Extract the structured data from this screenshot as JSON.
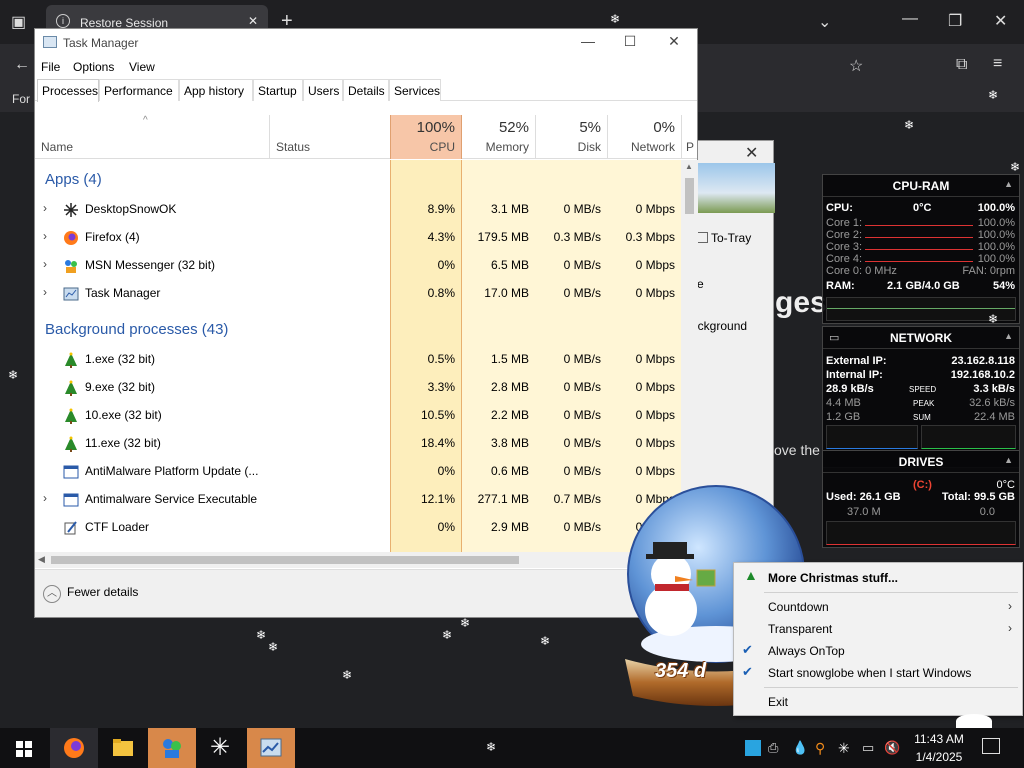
{
  "browser": {
    "tab_title": "Restore Session",
    "bookmarks_text": "For",
    "page_heading": "ges",
    "page_body_text": "ove the"
  },
  "restore_dialog": {
    "to_tray": "To-Tray",
    "option_e": "e",
    "background_label": "ackground"
  },
  "taskmanager": {
    "title": "Task Manager",
    "menu": [
      "File",
      "Options",
      "View"
    ],
    "tabs": [
      "Processes",
      "Performance",
      "App history",
      "Startup",
      "Users",
      "Details",
      "Services"
    ],
    "active_tab": "Processes",
    "columns": {
      "name": "Name",
      "status": "Status",
      "cpu_pct": "100%",
      "cpu": "CPU",
      "mem_pct": "52%",
      "mem": "Memory",
      "disk_pct": "5%",
      "disk": "Disk",
      "net_pct": "0%",
      "net": "Network",
      "power": "P"
    },
    "groups": [
      {
        "title": "Apps (4)",
        "rows": [
          {
            "name": "DesktopSnowOK",
            "cpu": "8.9%",
            "mem": "3.1 MB",
            "disk": "0 MB/s",
            "net": "0 Mbps",
            "icon": "snowflake-icon",
            "expand": true
          },
          {
            "name": "Firefox (4)",
            "cpu": "4.3%",
            "mem": "179.5 MB",
            "disk": "0.3 MB/s",
            "net": "0.3 Mbps",
            "icon": "firefox-icon",
            "expand": true
          },
          {
            "name": "MSN Messenger (32 bit)",
            "cpu": "0%",
            "mem": "6.5 MB",
            "disk": "0 MB/s",
            "net": "0 Mbps",
            "icon": "msn-icon",
            "expand": true
          },
          {
            "name": "Task Manager",
            "cpu": "0.8%",
            "mem": "17.0 MB",
            "disk": "0 MB/s",
            "net": "0 Mbps",
            "icon": "taskmanager-icon",
            "expand": true
          }
        ]
      },
      {
        "title": "Background processes (43)",
        "rows": [
          {
            "name": "1.exe (32 bit)",
            "cpu": "0.5%",
            "mem": "1.5 MB",
            "disk": "0 MB/s",
            "net": "0 Mbps",
            "icon": "xmas-tree-icon",
            "expand": false
          },
          {
            "name": "9.exe (32 bit)",
            "cpu": "3.3%",
            "mem": "2.8 MB",
            "disk": "0 MB/s",
            "net": "0 Mbps",
            "icon": "xmas-tree-icon",
            "expand": false
          },
          {
            "name": "10.exe (32 bit)",
            "cpu": "10.5%",
            "mem": "2.2 MB",
            "disk": "0 MB/s",
            "net": "0 Mbps",
            "icon": "xmas-tree-icon",
            "expand": false
          },
          {
            "name": "11.exe (32 bit)",
            "cpu": "18.4%",
            "mem": "3.8 MB",
            "disk": "0 MB/s",
            "net": "0 Mbps",
            "icon": "xmas-tree-icon",
            "expand": false
          },
          {
            "name": "AntiMalware Platform Update (...",
            "cpu": "0%",
            "mem": "0.6 MB",
            "disk": "0 MB/s",
            "net": "0 Mbps",
            "icon": "app-window-icon",
            "expand": false
          },
          {
            "name": "Antimalware Service Executable",
            "cpu": "12.1%",
            "mem": "277.1 MB",
            "disk": "0.7 MB/s",
            "net": "0 Mbps",
            "icon": "app-window-icon",
            "expand": true
          },
          {
            "name": "CTF Loader",
            "cpu": "0%",
            "mem": "2.9 MB",
            "disk": "0 MB/s",
            "net": "0 Mbps",
            "icon": "ctf-icon",
            "expand": false
          }
        ]
      }
    ],
    "fewer_details": "Fewer details"
  },
  "gadgets": {
    "cpuram": {
      "title": "CPU-RAM",
      "cpu_label": "CPU:",
      "cpu_temp": "0°C",
      "cpu_pct": "100.0%",
      "cores": [
        {
          "label": "Core 1:",
          "value": "100.0%"
        },
        {
          "label": "Core 2:",
          "value": "100.0%"
        },
        {
          "label": "Core 3:",
          "value": "100.0%"
        },
        {
          "label": "Core 4:",
          "value": "100.0%"
        }
      ],
      "clock": "Core 0: 0 MHz",
      "fan": "FAN: 0rpm",
      "ram_label": "RAM:",
      "ram_value": "2.1 GB/4.0 GB",
      "ram_pct": "54%"
    },
    "network": {
      "title": "NETWORK",
      "external_label": "External IP:",
      "external_ip": "23.162.8.118",
      "internal_label": "Internal IP:",
      "internal_ip": "192.168.10.2",
      "speed_down": "28.9 kB/s",
      "speed_label": "SPEED",
      "speed_up": "3.3 kB/s",
      "peak_down": "4.4 MB",
      "peak_label": "PEAK",
      "peak_up": "32.6 kB/s",
      "sum_down": "1.2 GB",
      "sum_label": "SUM",
      "sum_up": "22.4 MB"
    },
    "drives": {
      "title": "DRIVES",
      "drive": "(C:)",
      "temp": "0°C",
      "used": "Used: 26.1 GB",
      "total": "Total: 99.5 GB",
      "read": "37.0 M",
      "write": "0.0"
    }
  },
  "snowglobe": {
    "counter": "354 d"
  },
  "context_menu": {
    "items": [
      {
        "label": "More Christmas stuff...",
        "bold": true
      },
      {
        "label": "Countdown",
        "submenu": true
      },
      {
        "label": "Transparent",
        "submenu": true
      },
      {
        "label": "Always OnTop",
        "checked": true
      },
      {
        "label": "Start snowglobe when I start Windows",
        "checked": true
      },
      {
        "label": "Exit"
      }
    ]
  },
  "taskbar": {
    "time": "11:43 AM",
    "date": "1/4/2025"
  },
  "colors": {
    "cpu_heat_header": "#f7c6a8",
    "cpu_heat": "#fde9a6",
    "mem_heat": "#fff3c7",
    "group_blue": "#2a5aa8",
    "taskbar": "#101012"
  }
}
